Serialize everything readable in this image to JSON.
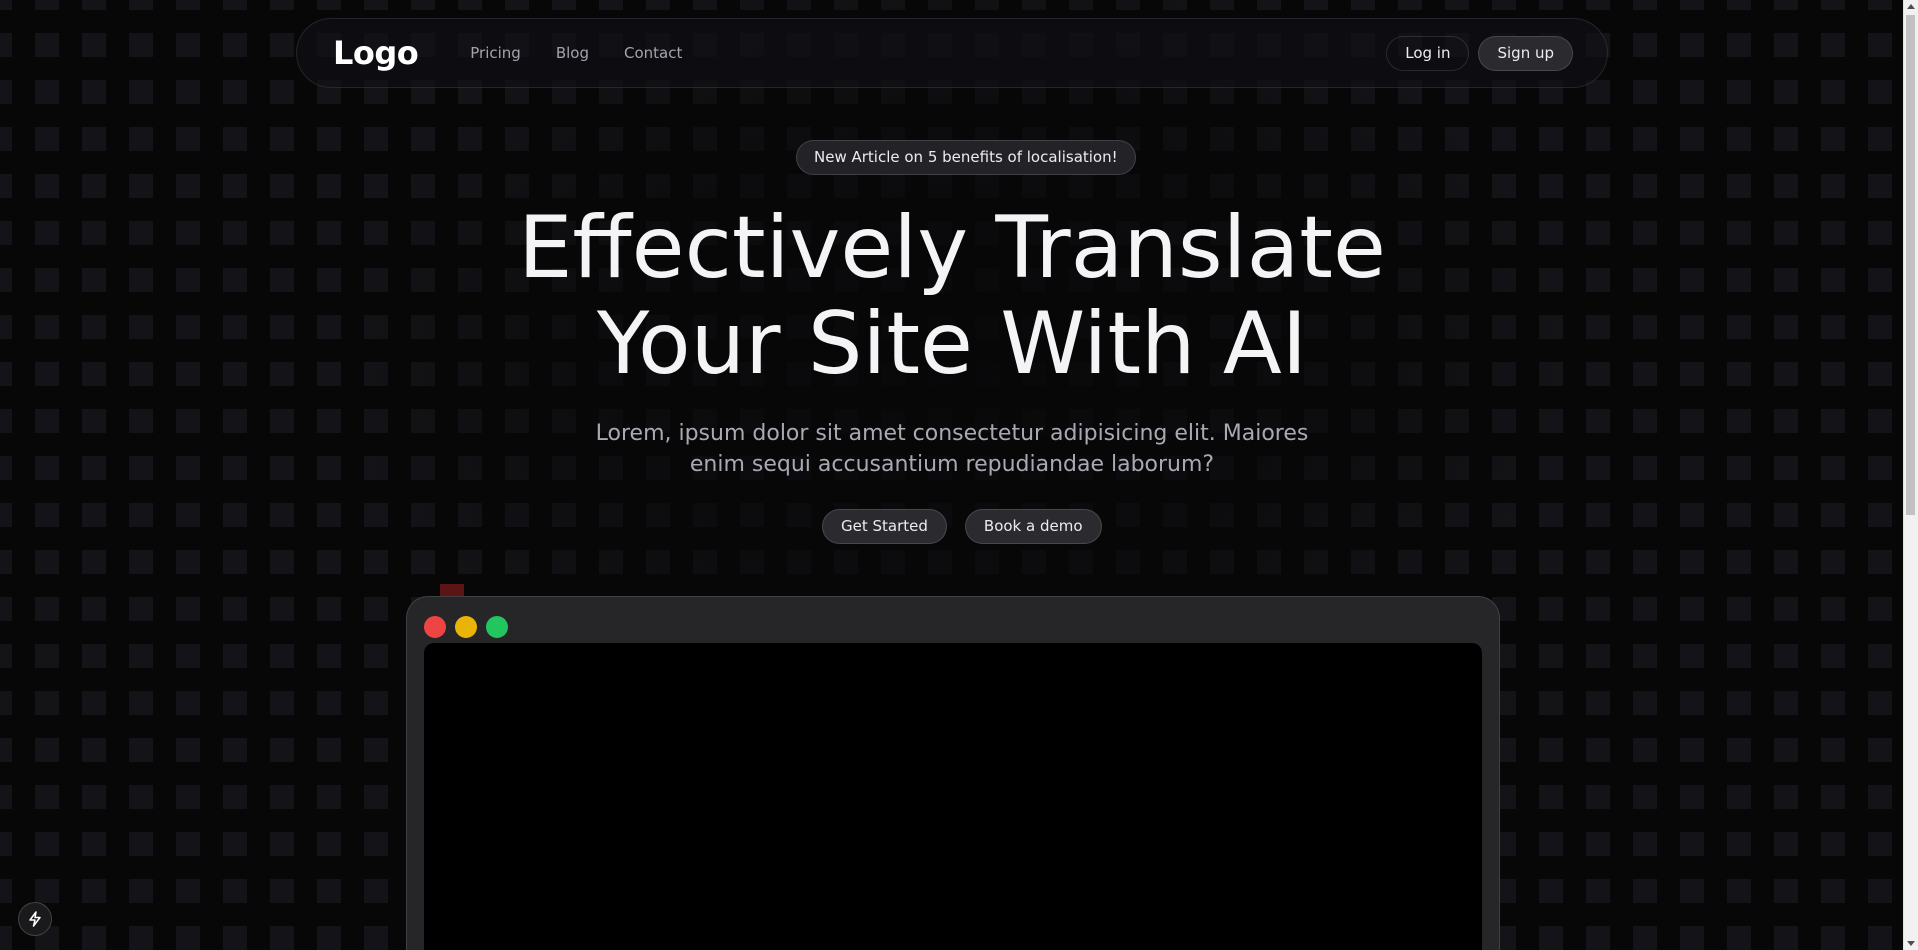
{
  "navbar": {
    "logo": "Logo",
    "links": [
      {
        "label": "Pricing"
      },
      {
        "label": "Blog"
      },
      {
        "label": "Contact"
      }
    ],
    "login_label": "Log in",
    "signup_label": "Sign up"
  },
  "announcement": {
    "label": "New Article on 5 benefits of localisation!"
  },
  "hero": {
    "title_line1": "Effectively Translate",
    "title_line2": "Your Site With AI",
    "subtitle_line1": "Lorem, ipsum dolor sit amet consectetur adipisicing elit. Maiores",
    "subtitle_line2": "enim sequi accusantium repudiandae laborum?",
    "primary_cta": "Get Started",
    "secondary_cta": "Book a demo"
  },
  "mockup": {
    "window_controls": [
      "red-dot",
      "yellow-dot",
      "green-dot"
    ]
  },
  "corner_button": {
    "icon": "bolt-icon"
  },
  "colors": {
    "background": "#070708",
    "text": "#f4f4f7",
    "muted_text": "#a9a9b3",
    "dot_red": "#ef4444",
    "dot_yellow": "#eab308",
    "dot_green": "#22c55e"
  }
}
